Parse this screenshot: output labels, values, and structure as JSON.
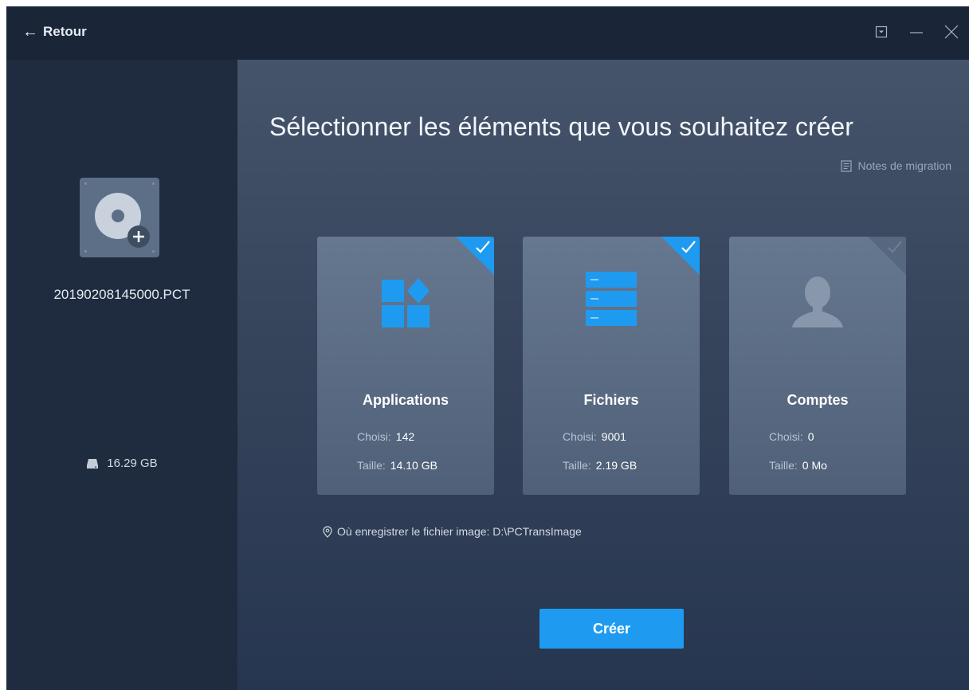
{
  "titlebar": {
    "back_label": "Retour",
    "controls": [
      "menu-icon",
      "minimize-icon",
      "close-icon"
    ]
  },
  "sidebar": {
    "filename": "20190208145000.PCT",
    "size": "16.29 GB",
    "icons": [
      "disk-image-add-icon",
      "drive-icon"
    ]
  },
  "main": {
    "title": "Sélectionner les éléments que vous souhaitez créer",
    "notes_link": "Notes de migration",
    "save_path": "Où enregistrer le fichier image: D:\\PCTransImage",
    "create_label": "Créer",
    "cards": [
      {
        "title": "Applications",
        "icon": "applications-icon",
        "selected": true,
        "chosen_label": "Choisi:",
        "chosen": "142",
        "size_label": "Taille:",
        "size": "14.10 GB"
      },
      {
        "title": "Fichiers",
        "icon": "files-icon",
        "selected": true,
        "chosen_label": "Choisi:",
        "chosen": "9001",
        "size_label": "Taille:",
        "size": "2.19 GB"
      },
      {
        "title": "Comptes",
        "icon": "accounts-icon",
        "selected": false,
        "chosen_label": "Choisi:",
        "chosen": "0",
        "size_label": "Taille:",
        "size": "0 Mo"
      }
    ]
  },
  "colors": {
    "accent": "#1e9bf0",
    "sidebar_bg": "#1f2c40",
    "titlebar_bg": "#1a2638",
    "card_bg": "#5b6c83"
  }
}
